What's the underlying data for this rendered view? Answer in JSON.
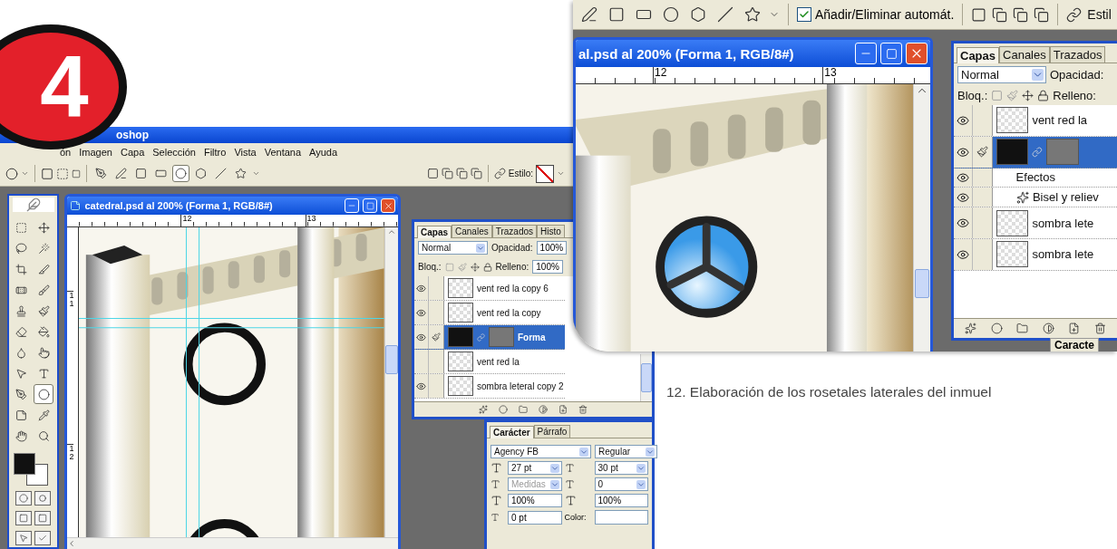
{
  "badge": {
    "label": "4"
  },
  "main_window": {
    "title": "oshop",
    "menu": [
      "ón",
      "Imagen",
      "Capa",
      "Selección",
      "Filtro",
      "Vista",
      "Ventana",
      "Ayuda"
    ],
    "options_bar": {
      "shape_tools": [
        {
          "kind": "pen",
          "selected": false
        },
        {
          "kind": "freeform_pen",
          "selected": false
        },
        {
          "kind": "rectangle",
          "selected": false
        },
        {
          "kind": "rounded_rectangle",
          "selected": false
        },
        {
          "kind": "ellipse",
          "selected": true
        },
        {
          "kind": "polygon",
          "selected": false
        },
        {
          "kind": "line",
          "selected": false
        },
        {
          "kind": "custom",
          "selected": false
        }
      ],
      "style_label": "Estilo:"
    },
    "tools": [
      {
        "kind": "marquee",
        "selected": false
      },
      {
        "kind": "move",
        "selected": false
      },
      {
        "kind": "lasso",
        "selected": false
      },
      {
        "kind": "wand",
        "selected": false
      },
      {
        "kind": "crop",
        "selected": false
      },
      {
        "kind": "slice",
        "selected": false
      },
      {
        "kind": "healing",
        "selected": false
      },
      {
        "kind": "brush",
        "selected": false
      },
      {
        "kind": "stamp",
        "selected": false
      },
      {
        "kind": "history_brush",
        "selected": false
      },
      {
        "kind": "eraser",
        "selected": false
      },
      {
        "kind": "bucket",
        "selected": false
      },
      {
        "kind": "blur",
        "selected": false
      },
      {
        "kind": "dodge",
        "selected": false
      },
      {
        "kind": "path_select",
        "selected": false
      },
      {
        "kind": "type",
        "selected": false
      },
      {
        "kind": "pen",
        "selected": false
      },
      {
        "kind": "ellipse",
        "selected": true
      },
      {
        "kind": "notes",
        "selected": false
      },
      {
        "kind": "eyedropper",
        "selected": false
      },
      {
        "kind": "hand",
        "selected": false
      },
      {
        "kind": "zoom",
        "selected": false
      }
    ],
    "document": {
      "title": "catedral.psd al 200% (Forma 1, RGB/8#)",
      "ruler_labels": [
        "12",
        "13"
      ],
      "vertical_ruler_labels": [
        "11",
        "12"
      ]
    },
    "layers_panel": {
      "tabs": [
        {
          "label": "Capas",
          "selected": true
        },
        {
          "label": "Canales",
          "selected": false
        },
        {
          "label": "Trazados",
          "selected": false
        },
        {
          "label": "Histo",
          "selected": false
        }
      ],
      "blend_mode": "Normal",
      "opacity_label": "Opacidad:",
      "opacity": "100%",
      "lock_label": "Bloq.:",
      "fill_label": "Relleno:",
      "fill": "100%",
      "layers": [
        {
          "kind": "layer",
          "name": "vent red la copy 6",
          "visible": true,
          "selected": false
        },
        {
          "kind": "layer",
          "name": "vent red la copy",
          "visible": true,
          "selected": false
        },
        {
          "kind": "shape",
          "name": "Forma",
          "visible": true,
          "selected": true
        },
        {
          "kind": "layer",
          "name": "vent red la",
          "visible": false,
          "selected": false
        },
        {
          "kind": "layer",
          "name": "sombra leteral copy 2",
          "visible": true,
          "selected": false
        }
      ]
    },
    "character_panel": {
      "tabs": [
        {
          "label": "Carácter",
          "selected": true
        },
        {
          "label": "Párrafo",
          "selected": false
        }
      ],
      "font": "Agency FB",
      "style": "Regular",
      "size": "27 pt",
      "leading": "30 pt",
      "kerning": "Medidas",
      "kerning_disabled": true,
      "tracking": "0",
      "vertical_scale": "100%",
      "horizontal_scale": "100%",
      "baseline": "0 pt",
      "color_label": "Color:"
    }
  },
  "zoomed_window": {
    "options_bar": {
      "shape_tools": [
        {
          "kind": "freeform_pen",
          "selected": false
        },
        {
          "kind": "rectangle",
          "selected": false
        },
        {
          "kind": "rounded_rectangle",
          "selected": false
        },
        {
          "kind": "ellipse",
          "selected": false
        },
        {
          "kind": "polygon",
          "selected": false
        },
        {
          "kind": "line",
          "selected": false
        },
        {
          "kind": "custom",
          "selected": false
        }
      ],
      "auto_add": {
        "label": "Añadir/Eliminar automát.",
        "checked": true
      },
      "style_label": "Estil"
    },
    "document": {
      "title": "al.psd al 200% (Forma 1, RGB/8#)",
      "ruler_labels": [
        "12",
        "13"
      ]
    },
    "layers_panel": {
      "tabs": [
        {
          "label": "Capas",
          "selected": true
        },
        {
          "label": "Canales",
          "selected": false
        },
        {
          "label": "Trazados",
          "selected": false
        }
      ],
      "blend_mode": "Normal",
      "opacity_label": "Opacidad:",
      "lock_label": "Bloq.:",
      "fill_label": "Relleno:",
      "layers": [
        {
          "kind": "layer",
          "name": "vent red la",
          "visible": true,
          "selected": false
        },
        {
          "kind": "shape",
          "visible": true,
          "selected": true
        },
        {
          "kind": "effects",
          "name": "Efectos",
          "visible": true,
          "selected": false
        },
        {
          "kind": "effect",
          "name": "Bisel y reliev",
          "visible": true,
          "selected": false
        },
        {
          "kind": "layer",
          "name": "sombra lete",
          "visible": true,
          "selected": false
        },
        {
          "kind": "layer",
          "name": "sombra lete",
          "visible": true,
          "selected": false
        }
      ],
      "next_panel_tab": "Caracte"
    }
  },
  "caption": "12. Elaboración de los rosetales laterales del inmuel"
}
